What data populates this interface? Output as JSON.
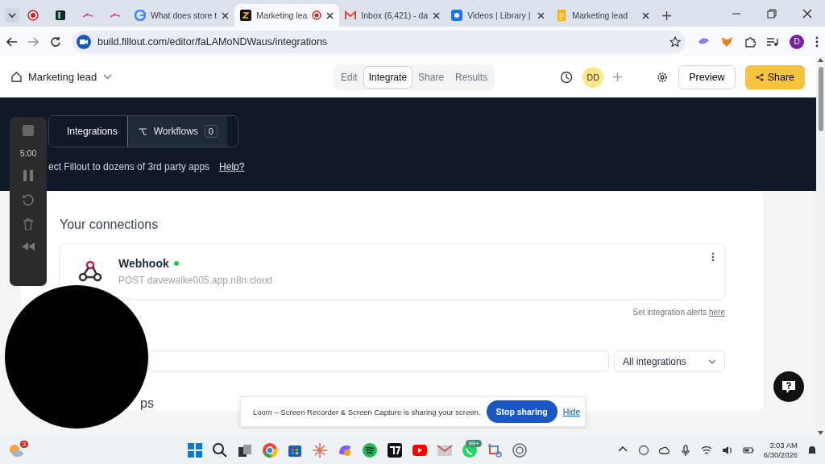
{
  "browser": {
    "tabs": [
      {
        "kind": "google",
        "title": "What does store t",
        "selected": false,
        "recording": false
      },
      {
        "kind": "fillout",
        "title": "Marketing lea",
        "selected": true,
        "recording": true
      },
      {
        "kind": "gmail",
        "title": "Inbox (6,421) - da",
        "selected": false,
        "recording": false
      },
      {
        "kind": "loom",
        "title": "Videos | Library |",
        "selected": false,
        "recording": false
      },
      {
        "kind": "docs",
        "title": "Marketing lead",
        "selected": false,
        "recording": false
      }
    ],
    "url": "build.fillout.com/editor/faLAMoNDWaus/integrations",
    "profile": "D"
  },
  "header": {
    "form_name": "Marketing lead",
    "modes": [
      {
        "label": "Edit",
        "selected": false
      },
      {
        "label": "Integrate",
        "selected": true
      },
      {
        "label": "Share",
        "selected": false
      },
      {
        "label": "Results",
        "selected": false
      }
    ],
    "avatar": "DD",
    "preview": "Preview",
    "share": "Share"
  },
  "subtabs": [
    {
      "label": "Integrations",
      "selected": true
    },
    {
      "label": "Workflows",
      "count": "0",
      "selected": false
    }
  ],
  "description": "ect Fillout to dozens of 3rd party apps",
  "help_link": "Help?",
  "connections": {
    "title": "Your connections",
    "items": [
      {
        "name": "Webhook",
        "connected": true,
        "detail": "POST davewalke005.app.n8n.cloud"
      }
    ],
    "alerts_text": "Set integration alerts",
    "alerts_link": "here"
  },
  "filter": {
    "category": "All integrations"
  },
  "apps_heading": "ps",
  "recorder": {
    "time": "5:00"
  },
  "sharing_bar": {
    "message": "Loom – Screen Recorder & Screen Capture is sharing your screen.",
    "stop": "Stop sharing",
    "hide": "Hide"
  },
  "taskbar": {
    "weather_badge": "3",
    "chat_badge": "99+",
    "time": "3:03 AM",
    "date": "6/30/2026"
  }
}
